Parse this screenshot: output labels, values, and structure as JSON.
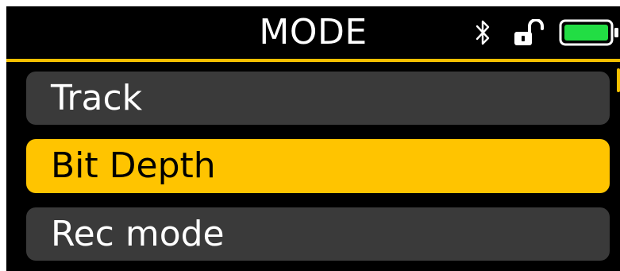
{
  "header": {
    "title": "MODE"
  },
  "status": {
    "bluetooth_icon": "bluetooth-icon",
    "lock_icon": "unlocked-padlock-icon",
    "battery_icon": "battery-icon",
    "battery_level": 1.0,
    "accent_color": "#f5c000",
    "battery_color": "#22dd44"
  },
  "menu": {
    "items": [
      {
        "label": "Track",
        "selected": false
      },
      {
        "label": "Bit Depth",
        "selected": true
      },
      {
        "label": "Rec mode",
        "selected": false
      }
    ]
  }
}
